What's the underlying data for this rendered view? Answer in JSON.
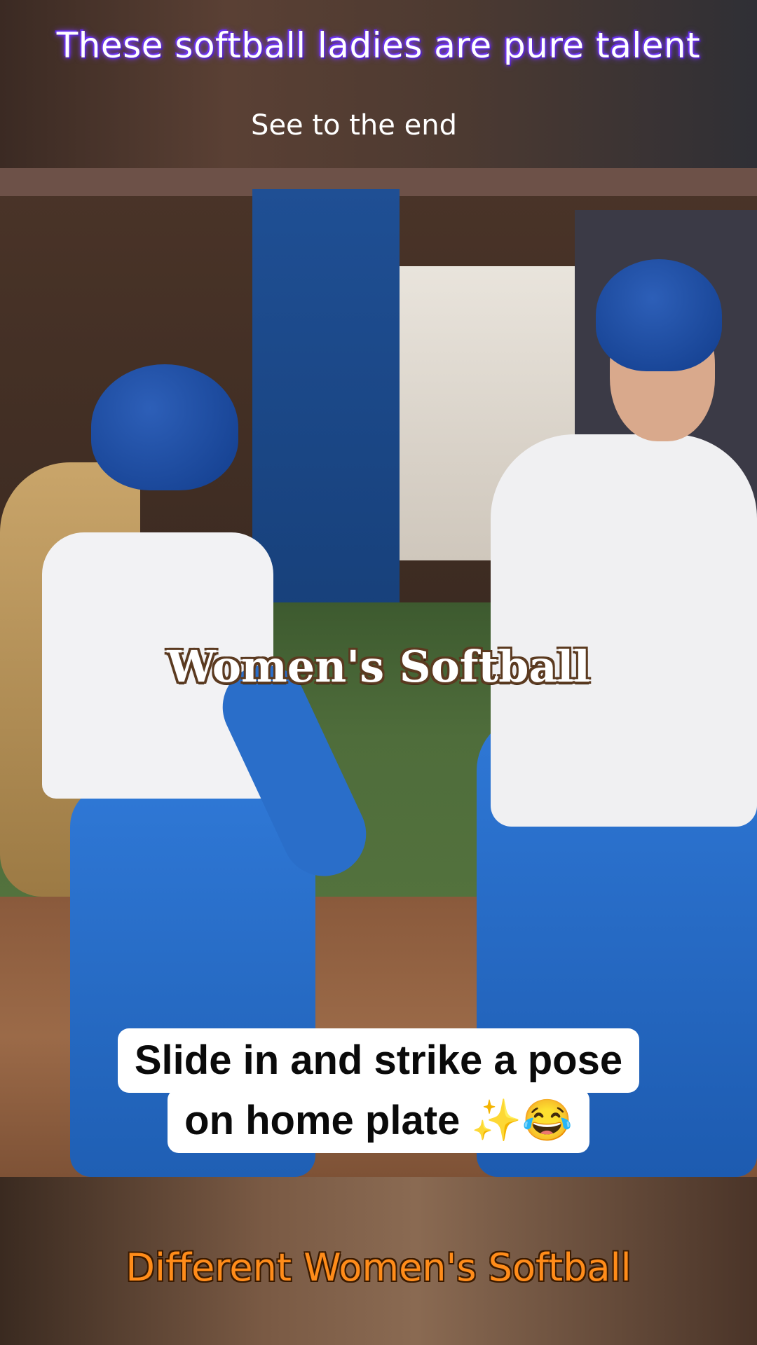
{
  "header": {
    "title": "These softball ladies are pure talent",
    "subtitle": "See to the end"
  },
  "video": {
    "overlay_title": "Women's Softball",
    "caption_line_1": "Slide in and strike a pose",
    "caption_line_2": "on home plate ✨😂"
  },
  "footer": {
    "title": "Different Women's Softball"
  },
  "colors": {
    "header_glow": "#7b3cff",
    "footer_text": "#ff8c1a",
    "caption_bg": "#ffffff"
  }
}
